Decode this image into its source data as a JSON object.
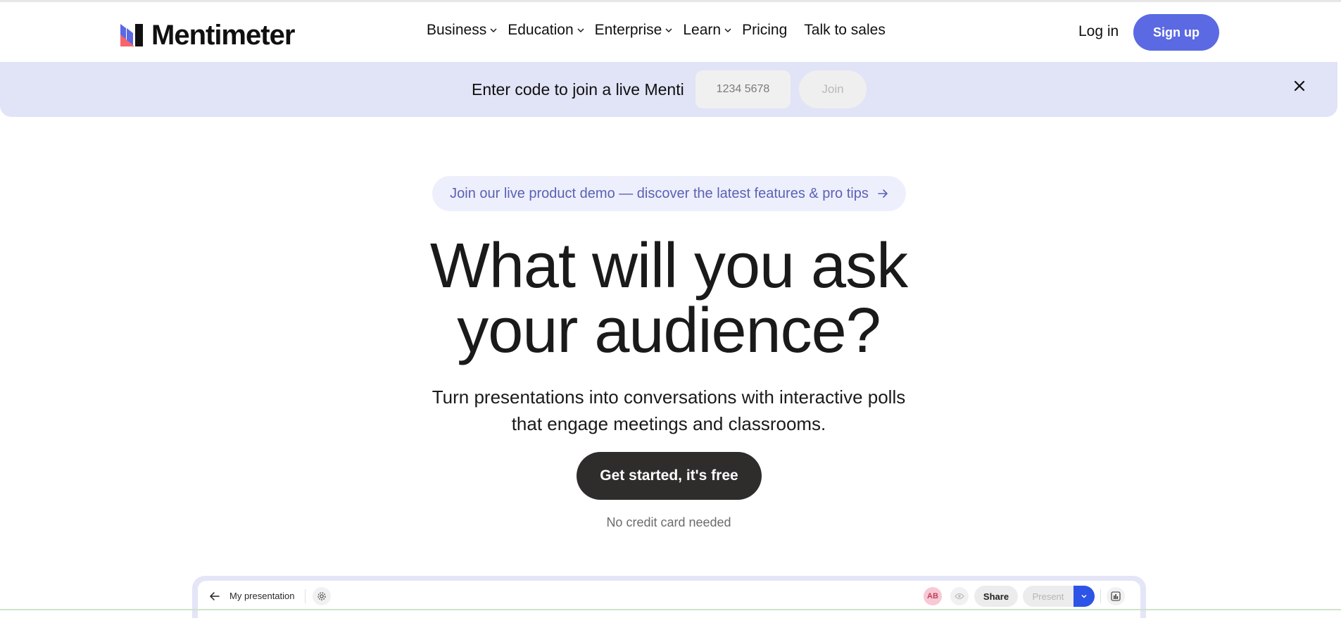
{
  "brand": {
    "name": "Mentimeter",
    "logo_icon": "mentimeter-logo-icon",
    "colors": {
      "blue": "#5b69e3",
      "red": "#f5656b",
      "dark": "#101010"
    }
  },
  "nav": {
    "items": [
      {
        "label": "Business",
        "has_dropdown": true
      },
      {
        "label": "Education",
        "has_dropdown": true
      },
      {
        "label": "Enterprise",
        "has_dropdown": true
      },
      {
        "label": "Learn",
        "has_dropdown": true
      },
      {
        "label": "Pricing",
        "has_dropdown": false
      },
      {
        "label": "Talk to sales",
        "has_dropdown": false
      }
    ],
    "login_label": "Log in",
    "signup_label": "Sign up"
  },
  "join_banner": {
    "label": "Enter code to join a live Menti",
    "code_placeholder": "1234 5678",
    "join_label": "Join",
    "close_icon": "close-icon",
    "background": "#e1e3f7"
  },
  "hero": {
    "promo": "Join our live product demo — discover the latest features & pro tips",
    "promo_icon": "arrow-right-icon",
    "title_line1": "What will you ask",
    "title_line2": "your audience?",
    "subtitle_line1": "Turn presentations into conversations with interactive polls",
    "subtitle_line2": "that engage meetings and classrooms.",
    "cta_label": "Get started, it's free",
    "cta_note": "No credit card needed"
  },
  "editor_preview": {
    "back_icon": "arrow-left-icon",
    "title": "My presentation",
    "settings_icon": "gear-icon",
    "avatar_initials": "AB",
    "preview_icon": "eye-icon",
    "share_label": "Share",
    "present_label": "Present",
    "present_dropdown_icon": "chevron-down-icon",
    "results_icon": "bar-chart-icon"
  }
}
